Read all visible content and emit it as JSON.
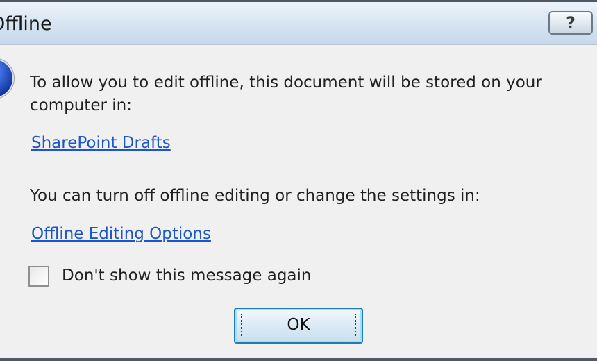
{
  "window": {
    "title": "Offline",
    "help_label": "?"
  },
  "message": {
    "text": "To allow you to edit offline, this document will be stored on your computer in:",
    "location_link": "SharePoint Drafts",
    "settings_text": "You can turn off offline editing or change the settings in:",
    "options_link": "Offline Editing Options"
  },
  "checkbox": {
    "label": "Don't show this message again",
    "checked": false
  },
  "buttons": {
    "ok_label": "OK"
  },
  "icons": {
    "info": "info-icon",
    "help": "help-icon"
  }
}
